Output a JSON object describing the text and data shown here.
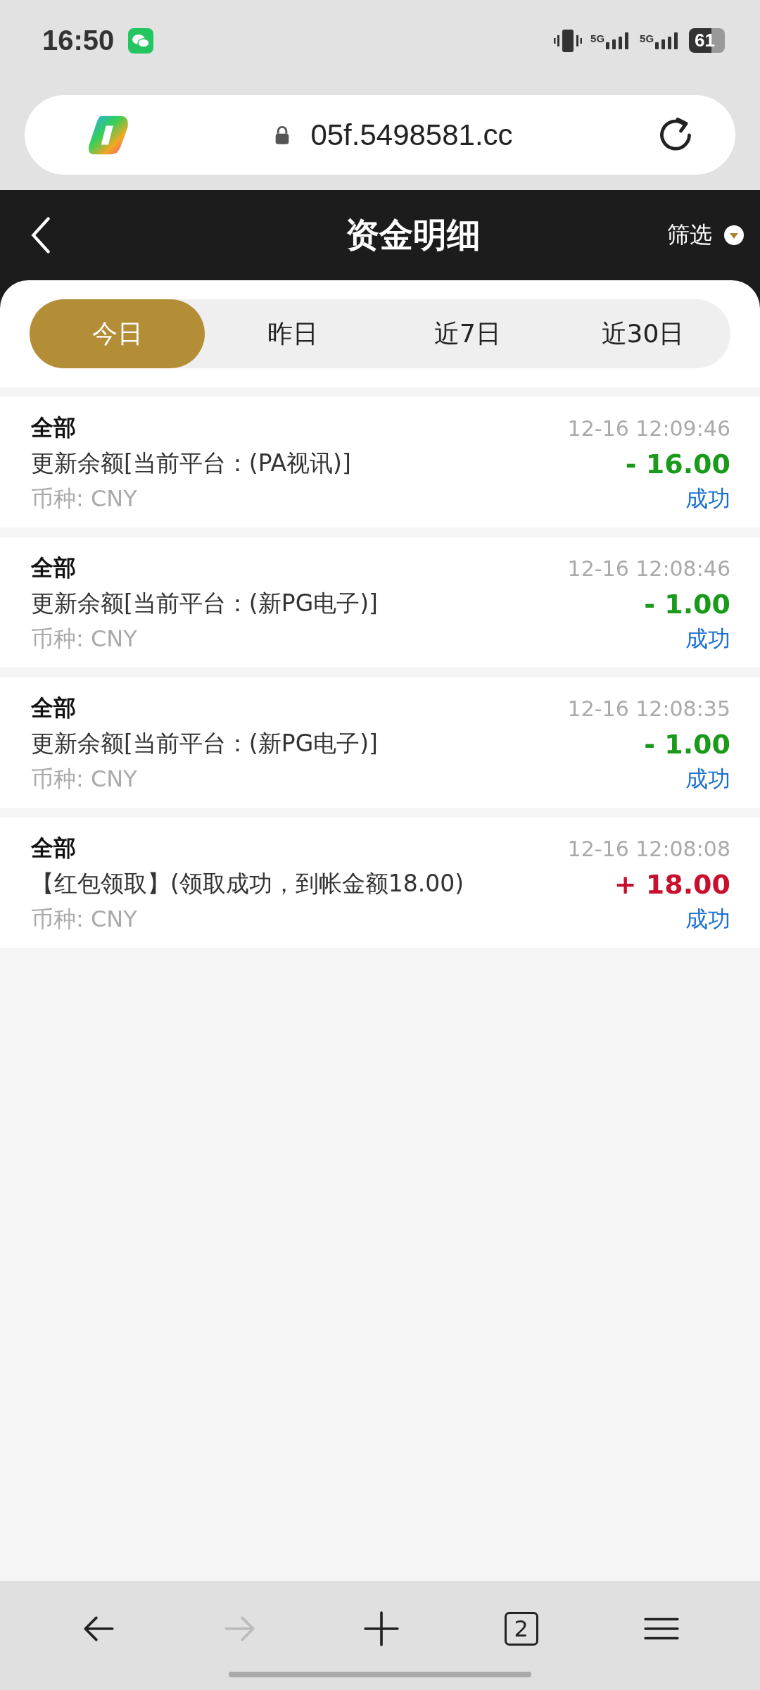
{
  "status_bar": {
    "time": "16:50",
    "network_1": "5G",
    "network_2": "5G",
    "battery": "61"
  },
  "browser": {
    "url": "05f.5498581.cc"
  },
  "header": {
    "title": "资金明细",
    "filter": "筛选"
  },
  "tabs": [
    {
      "label": "今日",
      "selected": true
    },
    {
      "label": "昨日",
      "selected": false
    },
    {
      "label": "近7日",
      "selected": false
    },
    {
      "label": "近30日",
      "selected": false
    }
  ],
  "records": [
    {
      "category": "全部",
      "time": "12-16 12:09:46",
      "description": "更新余额[当前平台：(PA视讯)]",
      "amount": "- 16.00",
      "kind": "expense",
      "currency": "币种: CNY",
      "status": "成功"
    },
    {
      "category": "全部",
      "time": "12-16 12:08:46",
      "description": "更新余额[当前平台：(新PG电子)]",
      "amount": "- 1.00",
      "kind": "expense",
      "currency": "币种: CNY",
      "status": "成功"
    },
    {
      "category": "全部",
      "time": "12-16 12:08:35",
      "description": "更新余额[当前平台：(新PG电子)]",
      "amount": "- 1.00",
      "kind": "expense",
      "currency": "币种: CNY",
      "status": "成功"
    },
    {
      "category": "全部",
      "time": "12-16 12:08:08",
      "description": "【红包领取】(领取成功，到帐金额18.00)",
      "amount": "+ 18.00",
      "kind": "income",
      "currency": "币种: CNY",
      "status": "成功"
    }
  ],
  "bottom_bar": {
    "forward_disabled": true,
    "tab_count": "2"
  }
}
